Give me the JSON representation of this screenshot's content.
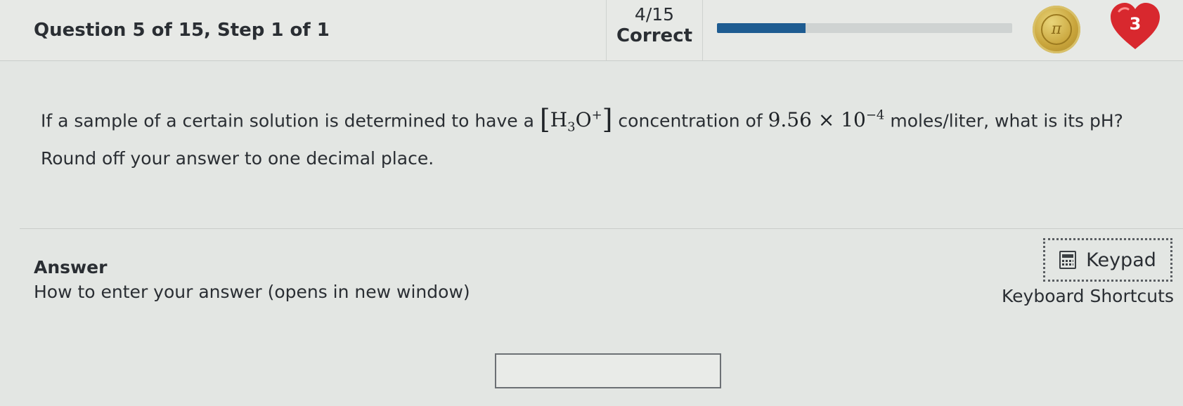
{
  "header": {
    "question_title": "Question 5 of 15, Step 1 of 1",
    "score_fraction": "4/15",
    "score_label": "Correct",
    "progress_fraction": 0.3,
    "hearts_count": "3",
    "accent_color": "#1e5c91"
  },
  "question": {
    "part1": "If a sample of a certain solution is determined to have a ",
    "species_H": "H",
    "species_sub": "3",
    "species_O": "O",
    "species_sup": "+",
    "part2": " concentration of ",
    "coefficient": "9.56",
    "times": "×",
    "base": "10",
    "exponent": "−4",
    "part3": " moles/liter, what is its pH?",
    "line2": "Round off your answer to one decimal place."
  },
  "answer": {
    "label": "Answer",
    "how_to_link": "How to enter your answer (opens in new window)",
    "keypad_label": "Keypad",
    "shortcuts_label": "Keyboard Shortcuts",
    "input_value": ""
  },
  "icons": {
    "coin": "coin-icon",
    "heart": "heart-icon",
    "keypad": "calculator-icon"
  }
}
